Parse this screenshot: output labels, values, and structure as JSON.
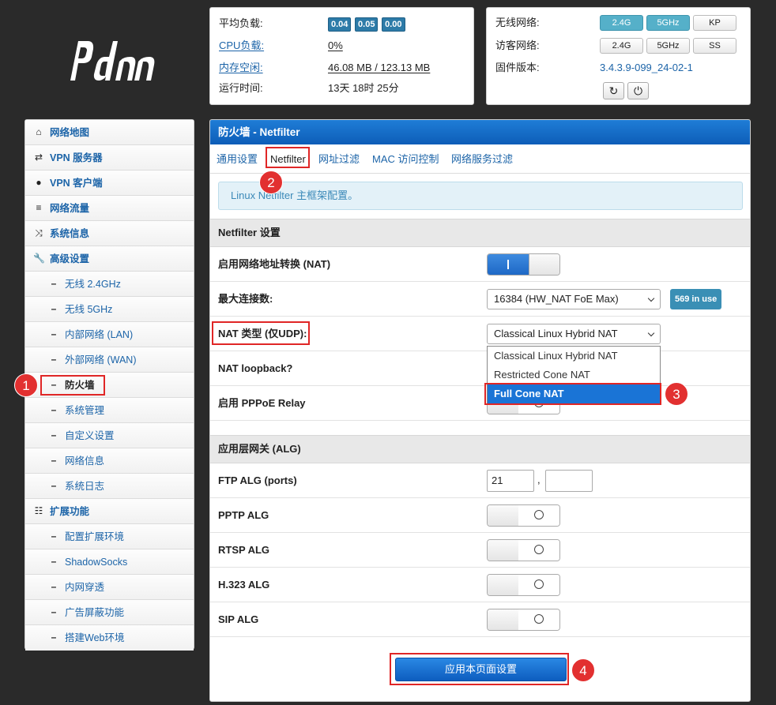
{
  "brand": {
    "logo_text": "pdcn"
  },
  "status": {
    "load_label": "平均负载:",
    "load_values": [
      "0.04",
      "0.05",
      "0.00"
    ],
    "cpu_label": "CPU负载:",
    "cpu_value": "0%",
    "mem_label": "内存空闲:",
    "mem_value": "46.08 MB / 123.13 MB",
    "uptime_label": "运行时间:",
    "uptime_value": "13天 18时 25分"
  },
  "radio": {
    "wireless_label": "无线网络:",
    "wireless_buttons": [
      "2.4G",
      "5GHz",
      "KP"
    ],
    "guest_label": "访客网络:",
    "guest_buttons": [
      "2.4G",
      "5GHz",
      "SS"
    ],
    "firmware_label": "固件版本:",
    "firmware_value": "3.4.3.9-099_24-02-1"
  },
  "sidebar": {
    "items": [
      {
        "label": "网络地图",
        "icon": "home-icon"
      },
      {
        "label": "VPN 服务器",
        "icon": "retweet-icon"
      },
      {
        "label": "VPN 客户端",
        "icon": "globe-icon"
      },
      {
        "label": "网络流量",
        "icon": "list-icon"
      },
      {
        "label": "系统信息",
        "icon": "random-icon"
      },
      {
        "label": "高级设置",
        "icon": "wrench-icon"
      },
      {
        "label": "无线 2.4GHz"
      },
      {
        "label": "无线 5GHz"
      },
      {
        "label": "内部网络 (LAN)"
      },
      {
        "label": "外部网络 (WAN)"
      },
      {
        "label": "防火墙"
      },
      {
        "label": "系统管理"
      },
      {
        "label": "自定义设置"
      },
      {
        "label": "网络信息"
      },
      {
        "label": "系统日志"
      },
      {
        "label": "扩展功能",
        "icon": "grid-icon"
      },
      {
        "label": "配置扩展环境"
      },
      {
        "label": "ShadowSocks"
      },
      {
        "label": "内网穿透"
      },
      {
        "label": "广告屏蔽功能"
      },
      {
        "label": "搭建Web环境"
      }
    ]
  },
  "main": {
    "title": "防火墙 - Netfilter",
    "tabs": [
      "通用设置",
      "Netfilter",
      "网址过滤",
      "MAC 访问控制",
      "网络服务过滤"
    ],
    "info": "Linux Netfilter 主框架配置。",
    "section1": "Netfilter 设置",
    "nat_label": "启用网络地址转换 (NAT)",
    "maxconn_label": "最大连接数:",
    "maxconn_value": "16384 (HW_NAT FoE Max)",
    "inuse": "569 in use",
    "nattype_label": "NAT 类型 (仅UDP):",
    "nattype_value": "Classical Linux Hybrid NAT",
    "nattype_options": [
      "Classical Linux Hybrid NAT",
      "Restricted Cone NAT",
      "Full Cone NAT"
    ],
    "loopback_label": "NAT loopback?",
    "pppoe_label": "启用 PPPoE Relay",
    "section2": "应用层网关 (ALG)",
    "ftp_label": "FTP ALG (ports)",
    "ftp_port1": "21",
    "ftp_sep": ",",
    "ftp_port2": "",
    "pptp_label": "PPTP ALG",
    "rtsp_label": "RTSP ALG",
    "h323_label": "H.323 ALG",
    "sip_label": "SIP ALG",
    "apply": "应用本页面设置"
  },
  "markers": [
    "1",
    "2",
    "3",
    "4"
  ]
}
